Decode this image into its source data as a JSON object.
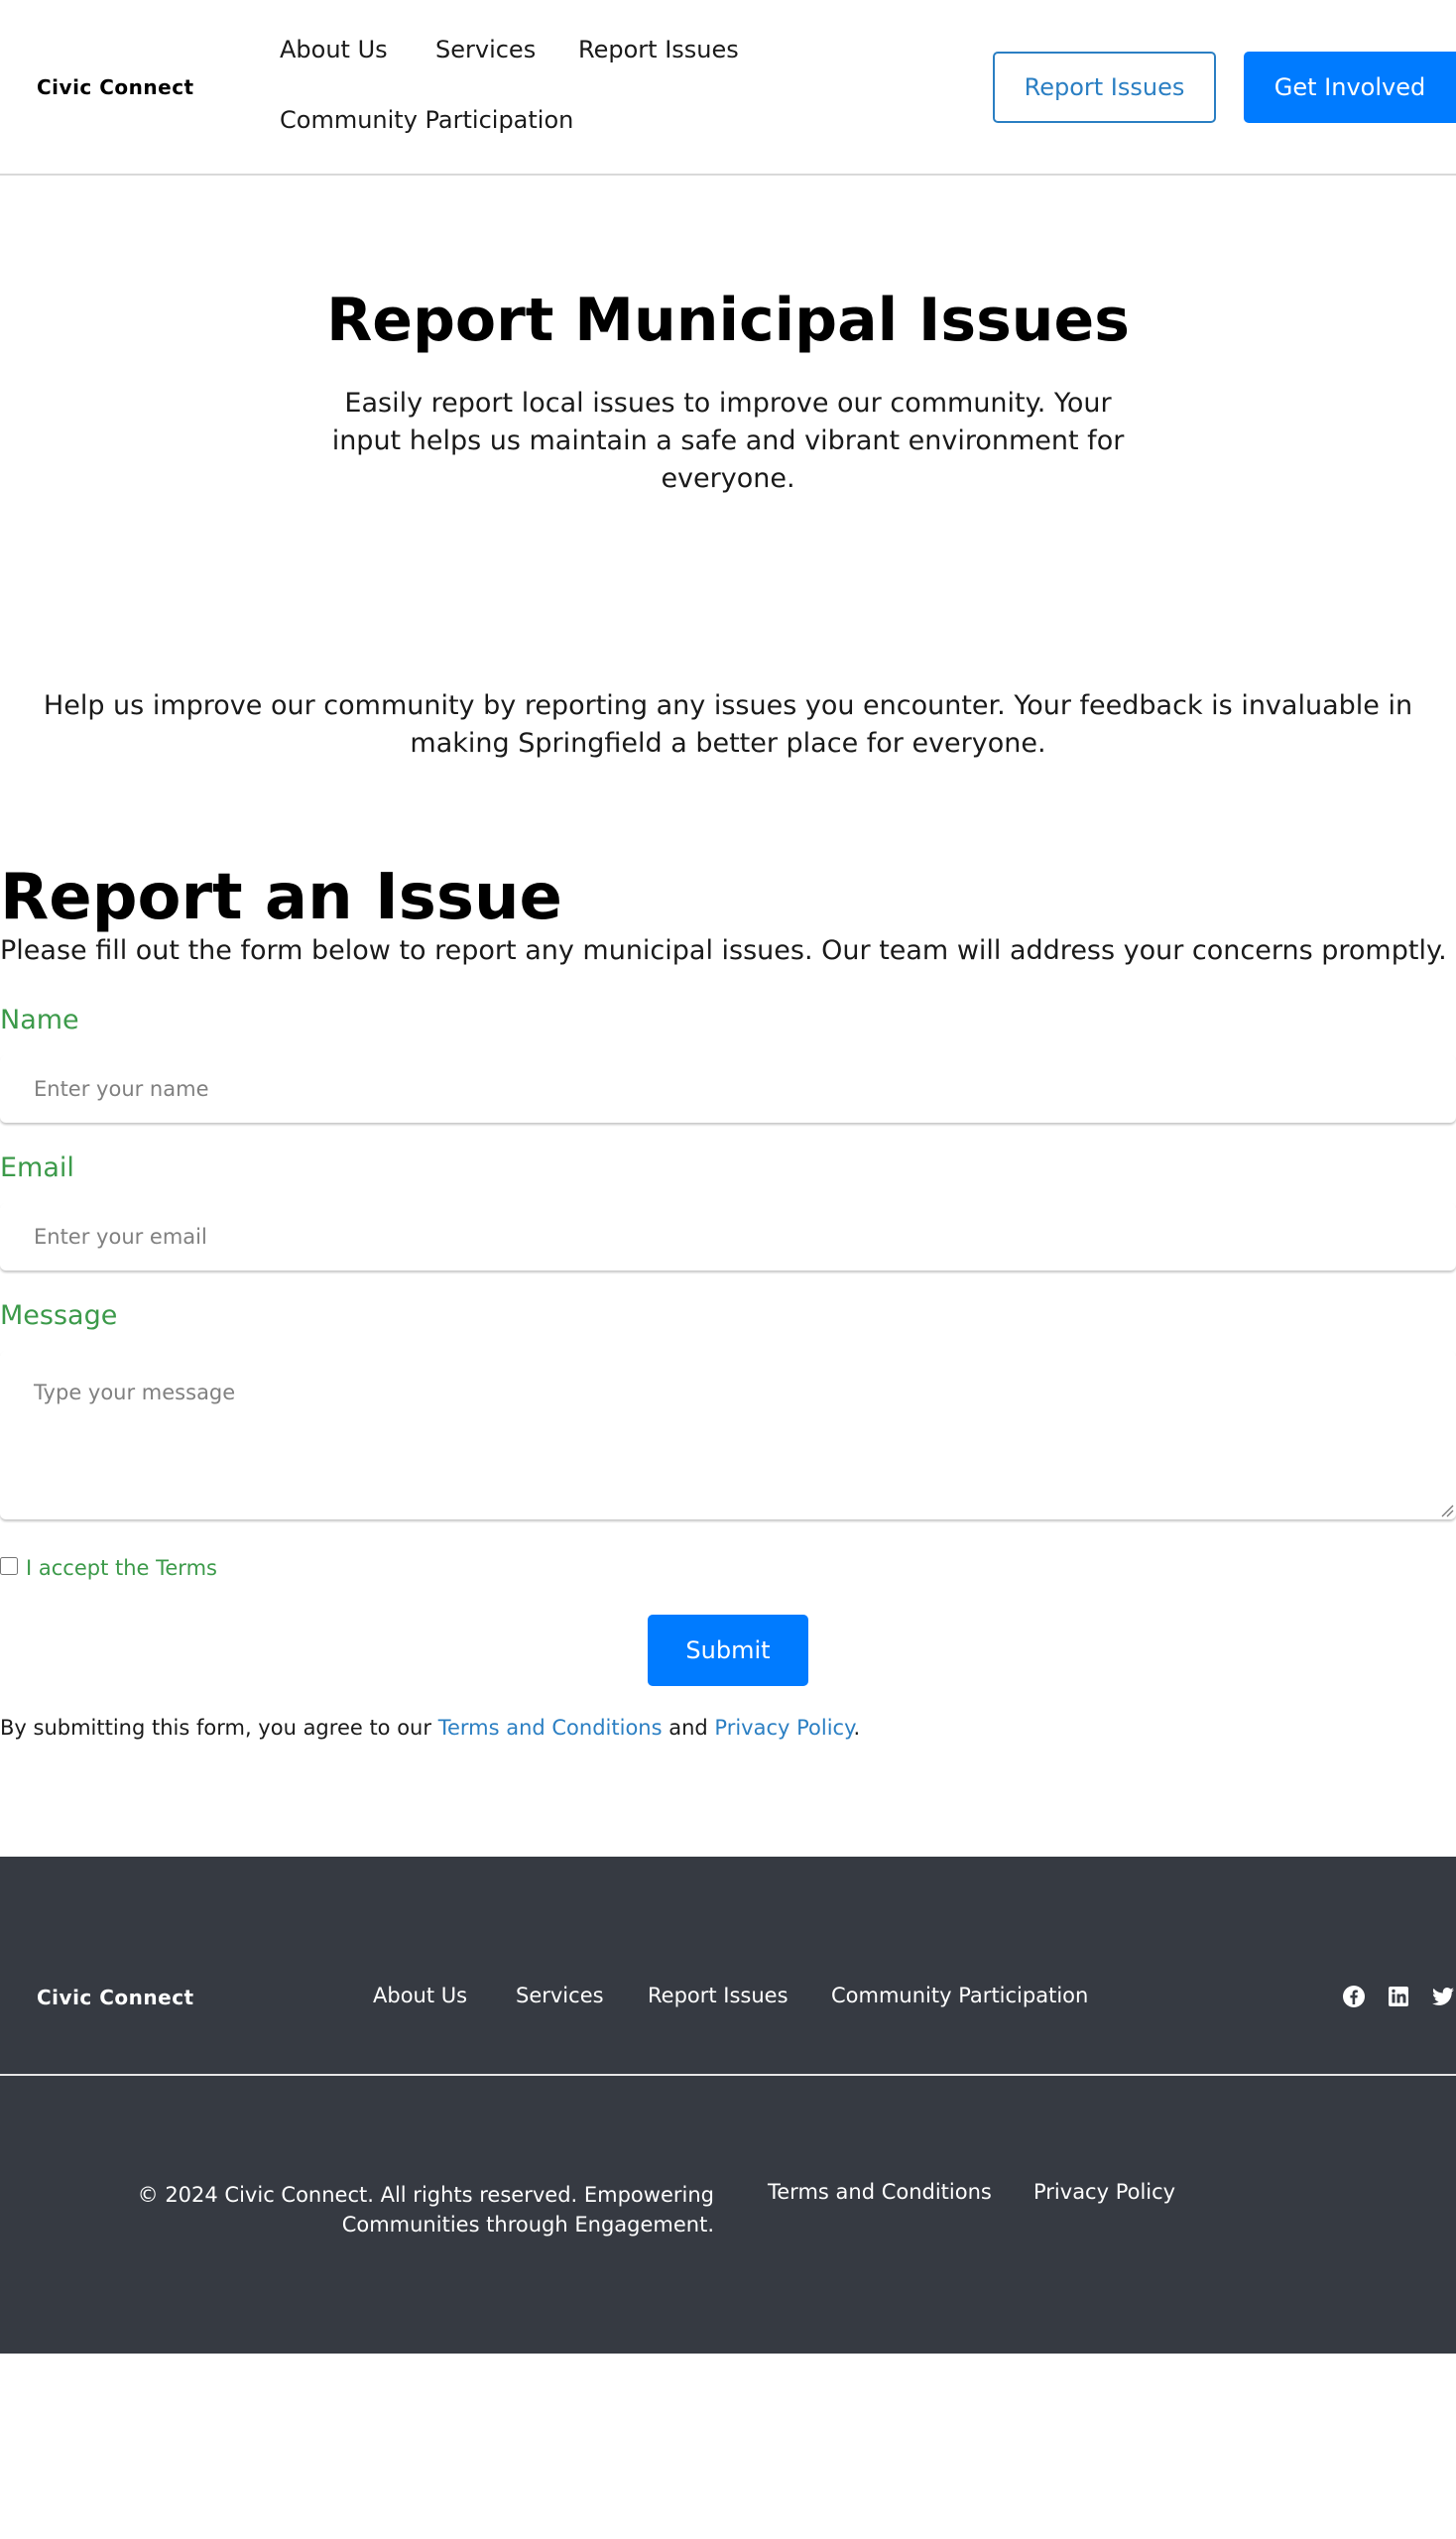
{
  "header": {
    "logo": "Civic Connect",
    "nav": [
      "About Us",
      "Services",
      "Report Issues",
      "Community Participation"
    ],
    "report_button": "Report Issues",
    "get_involved_button": "Get Involved"
  },
  "hero": {
    "title": "Report Municipal Issues",
    "subtitle": "Easily report local issues to improve our community. Your input helps us maintain a safe and vibrant environment for everyone."
  },
  "intro": {
    "text": "Help us improve our community by reporting any issues you encounter. Your feedback is invaluable in making Springfield a better place for everyone."
  },
  "form": {
    "title": "Report an Issue",
    "description": "Please fill out the form below to report any municipal issues. Our team will address your concerns promptly.",
    "name_label": "Name",
    "name_placeholder": "Enter your name",
    "email_label": "Email",
    "email_placeholder": "Enter your email",
    "message_label": "Message",
    "message_placeholder": "Type your message",
    "terms_checkbox_label": "I accept the Terms",
    "terms_checked": false,
    "submit_label": "Submit",
    "agree_prefix": "By submitting this form, you agree to our ",
    "agree_terms_link": "Terms and Conditions",
    "agree_and": " and ",
    "agree_privacy_link": "Privacy Policy",
    "agree_suffix": "."
  },
  "footer": {
    "logo": "Civic Connect",
    "nav": [
      "About Us",
      "Services",
      "Report Issues",
      "Community Participation"
    ],
    "social_icons": [
      "facebook-icon",
      "linkedin-icon",
      "twitter-icon"
    ],
    "copyright": "© 2024 Civic Connect. All rights reserved. Empowering Communities through Engagement.",
    "terms_link": "Terms and Conditions",
    "privacy_link": "Privacy Policy"
  },
  "colors": {
    "primary": "#007bff",
    "link": "#2b7fc3",
    "label_green": "#3c9a4a",
    "footer_bg": "#363a42"
  }
}
